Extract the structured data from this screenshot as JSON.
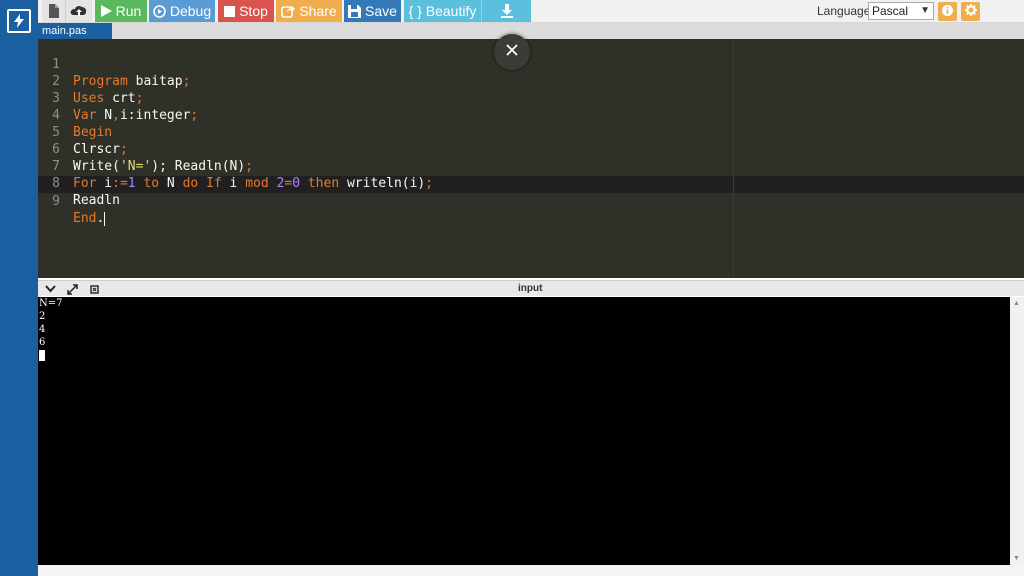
{
  "toolbar": {
    "run_label": "Run",
    "debug_label": "Debug",
    "stop_label": "Stop",
    "share_label": "Share",
    "save_label": "Save",
    "beautify_label": "{ } Beautify",
    "language_label": "Language",
    "language_value": "Pascal",
    "icons": [
      "new-file-icon",
      "upload-icon",
      "play-icon",
      "debug-icon",
      "stop-icon",
      "share-icon",
      "save-icon",
      "download-icon",
      "info-icon",
      "gear-icon"
    ]
  },
  "file_tab": "main.pas",
  "editor": {
    "line_numbers": [
      "1",
      "2",
      "3",
      "4",
      "5",
      "6",
      "7",
      "8",
      "9"
    ],
    "lines": {
      "l1": {
        "kw": "Program",
        "name": " baitap",
        "end": ";"
      },
      "l2": {
        "kw": "Uses",
        "name": " crt",
        "end": ";"
      },
      "l3": {
        "kw": "Var",
        "name": " N",
        "comma": ",",
        "rest": "i:integer",
        "end": ";"
      },
      "l4": {
        "kw": "Begin"
      },
      "l5": {
        "name": "Clrscr",
        "end": ";"
      },
      "l6": {
        "a": "Write(",
        "str": "'N='",
        "b": ");",
        "c": " Readln(N)",
        "end": ";"
      },
      "l7": {
        "for": "For",
        "i": " i",
        "assign": ":=",
        "one": "1",
        "to": " to",
        "n": " N",
        "do": " do",
        "if": " If",
        "i2": " i",
        "mod": " mod",
        "two": " 2",
        "eq": "=",
        "zero": "0",
        "then": " then",
        "call": " writeln(i)",
        "end": ";"
      },
      "l8": {
        "name": "Readln"
      },
      "l9": {
        "kw": "End",
        "end": "."
      }
    }
  },
  "console": {
    "title": "input",
    "output": [
      "N=7",
      "2",
      "4",
      "6"
    ]
  },
  "colors": {
    "rail": "#1a60a1",
    "editor_bg": "#2f3129",
    "run": "#5cb85c",
    "debug": "#5b9bd5",
    "stop": "#d9534f",
    "share": "#f0ad4e",
    "save": "#337ab7",
    "beautify": "#5bc0de"
  }
}
